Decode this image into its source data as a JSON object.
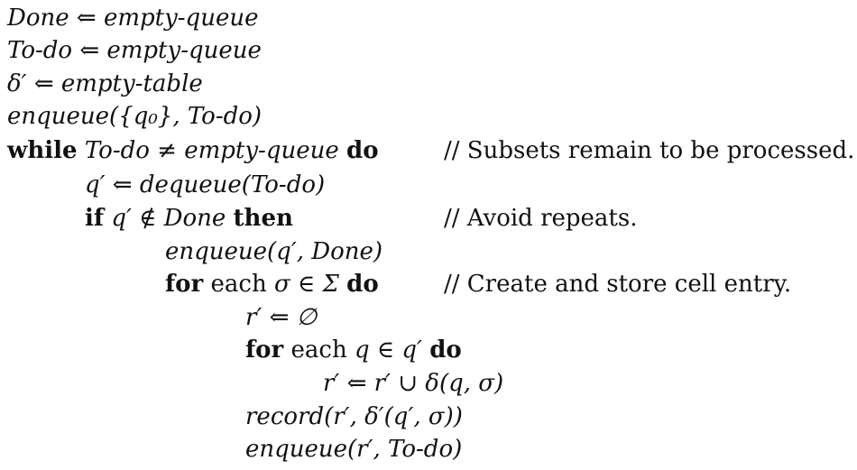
{
  "lines": [
    {
      "text": "Done ⇐ empty-queue"
    },
    {
      "text": "To-do ⇐ empty-queue"
    },
    {
      "text": "δ′ ⇐ empty-table"
    },
    {
      "text": "enqueue({q₀}, To-do)"
    },
    {
      "kw": "while",
      "text": "To-do ≠ empty-queue",
      "kw2": "do",
      "comment": "// Subsets remain to be processed."
    },
    {
      "text": "q′ ⇐ dequeue(To-do)"
    },
    {
      "kw": "if",
      "text": "q′ ∉ Done",
      "kw2": "then",
      "comment": "// Avoid repeats."
    },
    {
      "text": "enqueue(q′, Done)"
    },
    {
      "kw": "for",
      "mid": "each",
      "text": "σ ∈ Σ",
      "kw2": "do",
      "comment": "// Create and store cell entry."
    },
    {
      "text": "r′ ⇐ ∅"
    },
    {
      "kw": "for",
      "mid": "each",
      "text": "q ∈ q′",
      "kw2": "do"
    },
    {
      "text": "r′ ⇐ r′ ∪ δ(q, σ)"
    },
    {
      "text": "record(r′, δ′(q′, σ))"
    },
    {
      "text": "enqueue(r′, To-do)"
    }
  ]
}
